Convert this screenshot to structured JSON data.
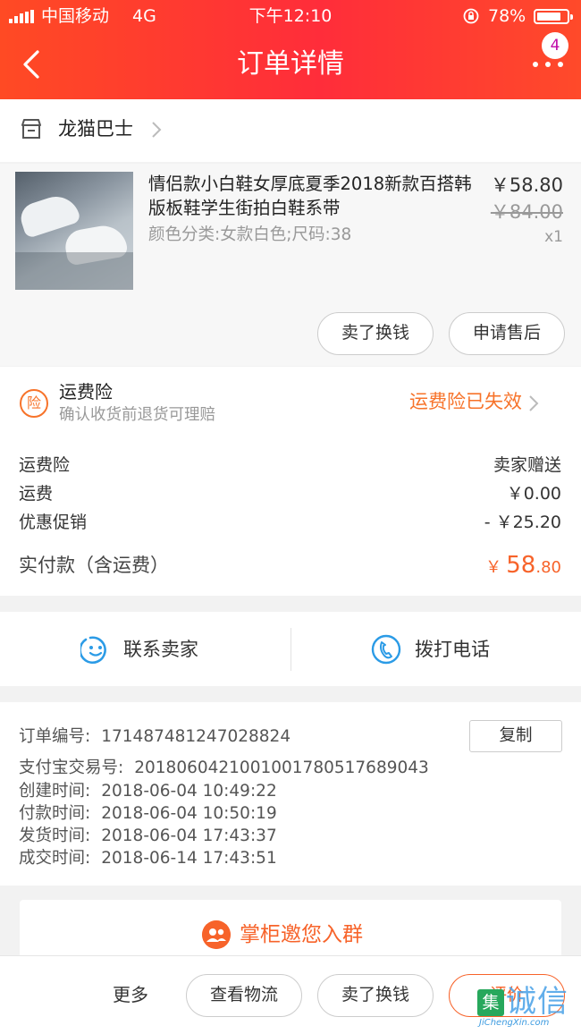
{
  "status_bar": {
    "carrier": "中国移动",
    "network": "4G",
    "time": "下午12:10",
    "battery": "78%"
  },
  "header": {
    "title": "订单详情",
    "badge_count": "4"
  },
  "shop": {
    "name": "龙猫巴士"
  },
  "product": {
    "title": "情侣款小白鞋女厚底夏季2018新款百搭韩版板鞋学生街拍白鞋系带",
    "spec": "颜色分类:女款白色;尺码:38",
    "price": "￥58.80",
    "original_price": "￥84.00",
    "quantity": "x1",
    "actions": {
      "sell": "卖了换钱",
      "after_sale": "申请售后"
    }
  },
  "insurance": {
    "icon_char": "险",
    "title": "运费险",
    "description": "确认收货前退货可理赔",
    "status": "运费险已失效"
  },
  "costs": {
    "rows": [
      {
        "label": "运费险",
        "value": "卖家赠送"
      },
      {
        "label": "运费",
        "value": "￥0.00"
      },
      {
        "label": "优惠促销",
        "value": "- ￥25.20"
      }
    ],
    "total_label": "实付款（含运费）",
    "total_currency": "￥",
    "total_integer": "58",
    "total_decimal": ".80"
  },
  "contact": {
    "seller": "联系卖家",
    "phone": "拨打电话"
  },
  "order_info": {
    "copy_label": "复制",
    "rows": [
      {
        "label": "订单编号:",
        "value": "171487481247028824"
      },
      {
        "label": "支付宝交易号:",
        "value": "2018060421001001780517689043"
      },
      {
        "label": "创建时间:",
        "value": "2018-06-04 10:49:22"
      },
      {
        "label": "付款时间:",
        "value": "2018-06-04 10:50:19"
      },
      {
        "label": "发货时间:",
        "value": "2018-06-04 17:43:37"
      },
      {
        "label": "成交时间:",
        "value": "2018-06-14 17:43:51"
      }
    ]
  },
  "invite": {
    "label": "掌柜邀您入群"
  },
  "bottom_bar": {
    "more": "更多",
    "logistics": "查看物流",
    "sell": "卖了换钱",
    "review": "评价"
  },
  "watermark": {
    "box_char": "集",
    "text": "诚信",
    "sub": "JiChengXin.com"
  },
  "colors": {
    "header_red": "#ff3334",
    "accent_orange": "#f7632a"
  }
}
